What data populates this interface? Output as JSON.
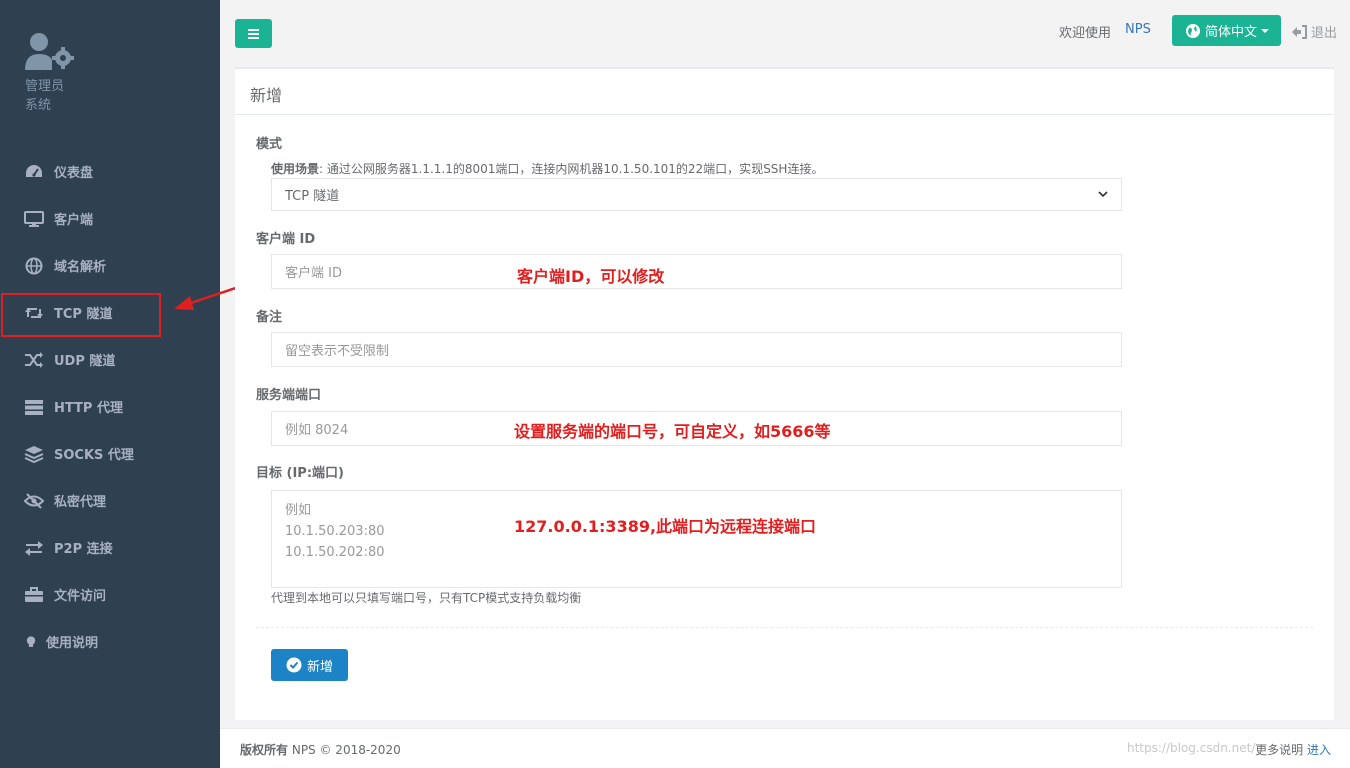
{
  "sidebar": {
    "profile": {
      "role": "管理员",
      "subtitle": "系统"
    },
    "items": [
      {
        "label": "仪表盘",
        "icon": "dashboard-icon"
      },
      {
        "label": "客户端",
        "icon": "monitor-icon"
      },
      {
        "label": "域名解析",
        "icon": "globe-icon"
      },
      {
        "label": "TCP 隧道",
        "icon": "retweet-icon"
      },
      {
        "label": "UDP 隧道",
        "icon": "random-icon"
      },
      {
        "label": "HTTP 代理",
        "icon": "server-icon"
      },
      {
        "label": "SOCKS 代理",
        "icon": "layers-icon"
      },
      {
        "label": "私密代理",
        "icon": "eye-slash-icon"
      },
      {
        "label": "P2P 连接",
        "icon": "exchange-icon"
      },
      {
        "label": "文件访问",
        "icon": "briefcase-icon"
      },
      {
        "label": "使用说明",
        "icon": "lightbulb-icon"
      }
    ]
  },
  "topbar": {
    "welcome": "欢迎使用",
    "brand": "NPS",
    "language": "简体中文",
    "logout": "退出"
  },
  "form": {
    "title": "新增",
    "mode_label": "模式",
    "scenario_prefix": "使用场景",
    "scenario_text": ": 通过公网服务器1.1.1.1的8001端口，连接内网机器10.1.50.101的22端口，实现SSH连接。",
    "mode_value": "TCP 隧道",
    "client_id_label": "客户端 ID",
    "client_id_placeholder": "客户端 ID",
    "remark_label": "备注",
    "remark_placeholder": "留空表示不受限制",
    "server_port_label": "服务端端口",
    "server_port_placeholder": "例如 8024",
    "target_label": "目标 (IP:端口)",
    "target_placeholder": "例如\n10.1.50.203:80\n10.1.50.202:80",
    "target_help": "代理到本地可以只填写端口号，只有TCP模式支持负载均衡",
    "submit_label": "新增"
  },
  "annotations": {
    "client_id": "客户端ID，可以修改",
    "server_port": "设置服务端的端口号，可自定义，如5666等",
    "target": "127.0.0.1:3389,此端口为远程连接端口",
    "color": "#e02020"
  },
  "footer": {
    "copyright_label": "版权所有",
    "copyright_text": "NPS © 2018-2020",
    "more_label": "更多说明",
    "more_link": "进入",
    "watermark": "https://blog.csdn.net/"
  },
  "colors": {
    "sidebar": "#2f4050",
    "primary": "#1ab394",
    "submit": "#1c84c6",
    "link": "#337ab7"
  }
}
